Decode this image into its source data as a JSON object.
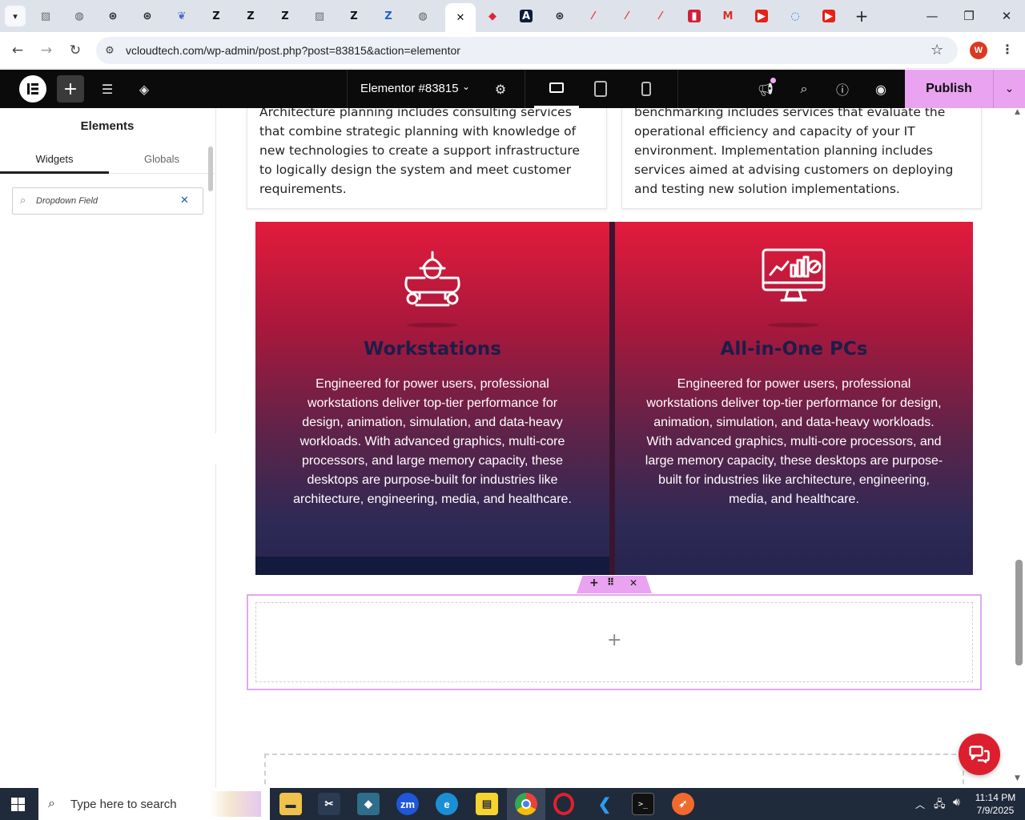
{
  "browser": {
    "tabs": [
      {
        "icon": "generic-page-icon",
        "glyph": "▨",
        "color": "#6b6b6b"
      },
      {
        "icon": "globe-icon",
        "glyph": "◍",
        "color": "#5a5a5a"
      },
      {
        "icon": "openai-icon",
        "glyph": "⊛",
        "color": "#222222"
      },
      {
        "icon": "openai-icon",
        "glyph": "⊛",
        "color": "#222222"
      },
      {
        "icon": "bird-icon",
        "glyph": "❦",
        "color": "#4a67c9"
      },
      {
        "icon": "z-logo-icon",
        "glyph": "Z",
        "color": "#111111"
      },
      {
        "icon": "z-logo-icon",
        "glyph": "Z",
        "color": "#111111"
      },
      {
        "icon": "z-logo-icon",
        "glyph": "Z",
        "color": "#111111"
      },
      {
        "icon": "generic-page-icon",
        "glyph": "▨",
        "color": "#6b6b6b"
      },
      {
        "icon": "z-logo-icon",
        "glyph": "Z",
        "color": "#111111"
      },
      {
        "icon": "z-blue-logo-icon",
        "glyph": "Z",
        "color": "#1d63c9"
      },
      {
        "icon": "globe-icon",
        "glyph": "◍",
        "color": "#5a5a5a"
      },
      {
        "icon": "close-icon",
        "glyph": "✕",
        "color": "#111111",
        "active": true
      },
      {
        "icon": "elementor-red-icon",
        "glyph": "◆",
        "color": "#e0243c"
      },
      {
        "icon": "a-logo-icon",
        "glyph": "A",
        "color": "#ffffff",
        "bg": "#0f1b3a"
      },
      {
        "icon": "openai-icon",
        "glyph": "⊛",
        "color": "#222222"
      },
      {
        "icon": "slash-logo-icon",
        "glyph": "⁄",
        "color": "#e23b3b"
      },
      {
        "icon": "slash-logo-icon",
        "glyph": "⁄",
        "color": "#e23b3b"
      },
      {
        "icon": "slash-logo-icon",
        "glyph": "⁄",
        "color": "#e23b3b"
      },
      {
        "icon": "red-square-icon",
        "glyph": "▮",
        "color": "#ffffff",
        "bg": "#d0213b"
      },
      {
        "icon": "gmail-icon",
        "glyph": "M",
        "color": "#d93025"
      },
      {
        "icon": "youtube-icon",
        "glyph": "▶",
        "color": "#ffffff",
        "bg": "#e62117"
      },
      {
        "icon": "loading-icon",
        "glyph": "◌",
        "color": "#1a73e8"
      },
      {
        "icon": "youtube-icon",
        "glyph": "▶",
        "color": "#ffffff",
        "bg": "#e62117"
      }
    ],
    "url": "vcloudtech.com/wp-admin/post.php?post=83815&action=elementor",
    "profile_initial": "W"
  },
  "editor": {
    "document_title": "Elementor #83815",
    "publish_label": "Publish"
  },
  "panel": {
    "title": "Elements",
    "tabs": [
      "Widgets",
      "Globals"
    ],
    "search_value": "Dropdown Field"
  },
  "canvas": {
    "card_left_text": [
      "Architecture planning includes consulting services",
      "that combine strategic planning with knowledge of",
      "new technologies to create a support infrastructure",
      "to logically design the system and meet customer",
      "requirements."
    ],
    "card_right_text": [
      "benchmarking includes services that evaluate the",
      "operational efficiency and capacity of your IT",
      "environment. Implementation planning includes",
      "services aimed at advising customers on deploying",
      "and testing new solution implementations."
    ],
    "col_left": {
      "title": "Workstations",
      "lines": [
        "Engineered for power users, professional",
        "workstations deliver top-tier performance for",
        "design, animation, simulation, and data-heavy",
        "workloads. With advanced graphics, multi-core",
        "processors, and large memory capacity, these",
        "desktops are purpose-built for industries like",
        "architecture, engineering, media, and healthcare."
      ]
    },
    "col_right": {
      "title": "All-in-One PCs",
      "lines": [
        "Engineered for power users, professional",
        "workstations deliver top-tier performance for design,",
        "animation, simulation, and data-heavy workloads.",
        "With advanced graphics, multi-core processors, and",
        "large memory capacity, these desktops are purpose-",
        "built for industries like architecture, engineering,",
        "media, and healthcare."
      ]
    }
  },
  "taskbar": {
    "search_placeholder": "Type here to search",
    "time": "11:14 PM",
    "date": "7/9/2025"
  },
  "colors": {
    "publish_bg": "#eaa3f0",
    "brand_red": "#e31b3c",
    "heading_navy": "#1c1d4a",
    "section_outline": "#e3a8ee"
  }
}
